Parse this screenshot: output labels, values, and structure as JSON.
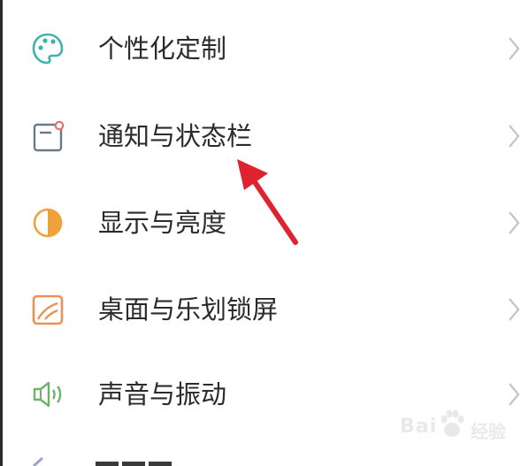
{
  "settings": {
    "items": [
      {
        "label": "个性化定制",
        "icon": "palette-icon",
        "color": "#3fb3a8"
      },
      {
        "label": "通知与状态栏",
        "icon": "notification-icon",
        "color": "#6c7a86"
      },
      {
        "label": "显示与亮度",
        "icon": "brightness-icon",
        "color": "#f0a23a"
      },
      {
        "label": "桌面与乐划锁屏",
        "icon": "wallpaper-icon",
        "color": "#e8925a"
      },
      {
        "label": "声音与振动",
        "icon": "speaker-icon",
        "color": "#6fb36a"
      }
    ]
  },
  "watermark": {
    "brand": "Bai",
    "suffix": "经验"
  },
  "accent_arrow_color": "#e0212e"
}
